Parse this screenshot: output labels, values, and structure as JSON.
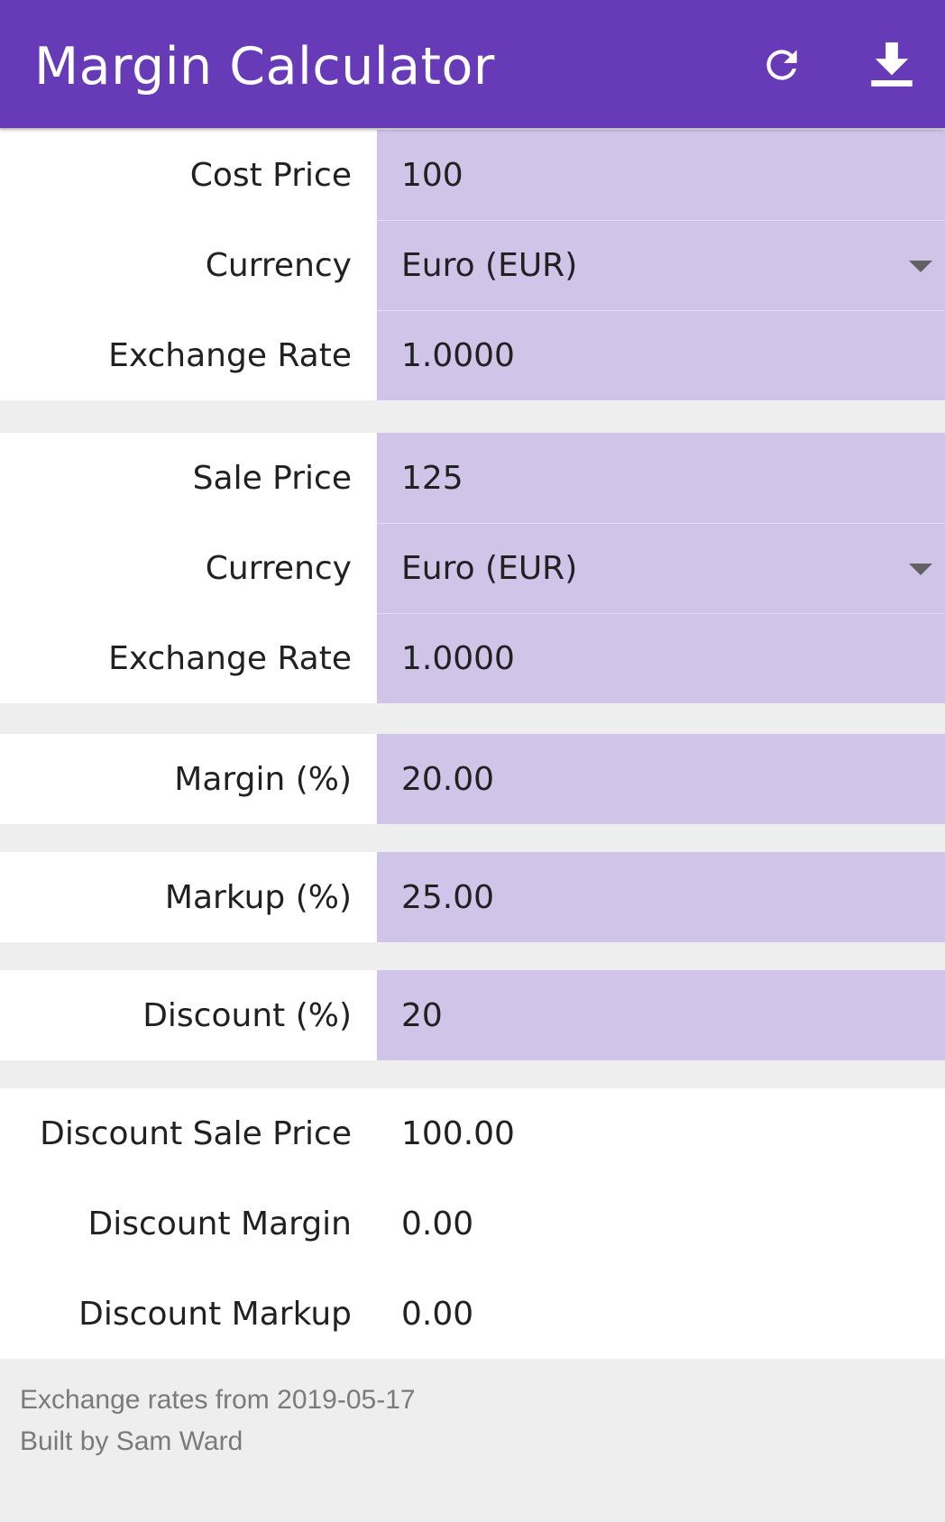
{
  "app": {
    "title": "Margin Calculator",
    "refresh_icon": "refresh-icon",
    "download_icon": "download-icon",
    "accent_color": "#673ab7",
    "field_color": "#d1c4e9"
  },
  "cost": {
    "price_label": "Cost Price",
    "price_value": "100",
    "currency_label": "Currency",
    "currency_value": "Euro (EUR)",
    "rate_label": "Exchange Rate",
    "rate_value": "1.0000"
  },
  "sale": {
    "price_label": "Sale Price",
    "price_value": "125",
    "currency_label": "Currency",
    "currency_value": "Euro (EUR)",
    "rate_label": "Exchange Rate",
    "rate_value": "1.0000"
  },
  "margin": {
    "label": "Margin (%)",
    "value": "20.00"
  },
  "markup": {
    "label": "Markup (%)",
    "value": "25.00"
  },
  "discount": {
    "label": "Discount (%)",
    "value": "20"
  },
  "results": {
    "sale_price_label": "Discount Sale Price",
    "sale_price_value": "100.00",
    "margin_label": "Discount Margin",
    "margin_value": "0.00",
    "markup_label": "Discount Markup",
    "markup_value": "0.00"
  },
  "footer": {
    "rates_note": "Exchange rates from 2019-05-17",
    "credit": "Built by Sam Ward"
  }
}
